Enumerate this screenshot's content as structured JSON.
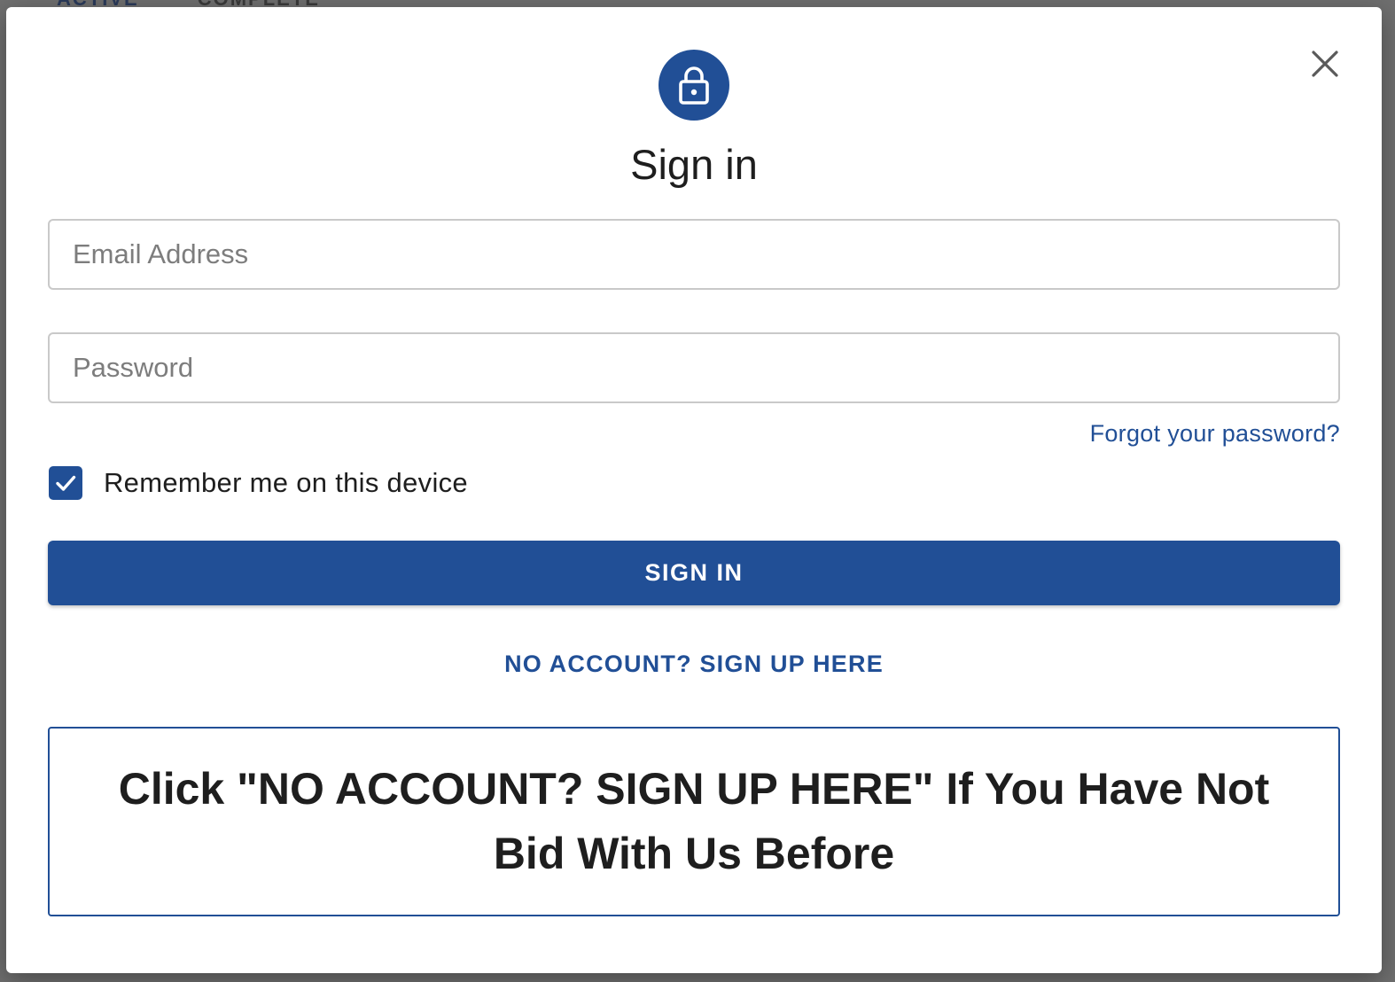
{
  "backdrop": {
    "tabs": [
      "ACTIVE",
      "COMPLETE"
    ]
  },
  "dialog": {
    "icon": "lock-icon",
    "title": "Sign in",
    "close_icon": "close-icon",
    "email": {
      "placeholder": "Email Address",
      "value": ""
    },
    "password": {
      "placeholder": "Password",
      "value": ""
    },
    "forgot_password": "Forgot your password?",
    "remember_me": {
      "label": "Remember me on this device",
      "checked": true
    },
    "sign_in_button": "SIGN IN",
    "sign_up_link": "NO ACCOUNT? SIGN UP HERE",
    "notice": "Click \"NO ACCOUNT? SIGN UP HERE\" If You Have Not Bid With Us Before"
  },
  "colors": {
    "primary": "#214f96",
    "backdrop": "#6f6f6f",
    "text": "#1e1e1e"
  }
}
